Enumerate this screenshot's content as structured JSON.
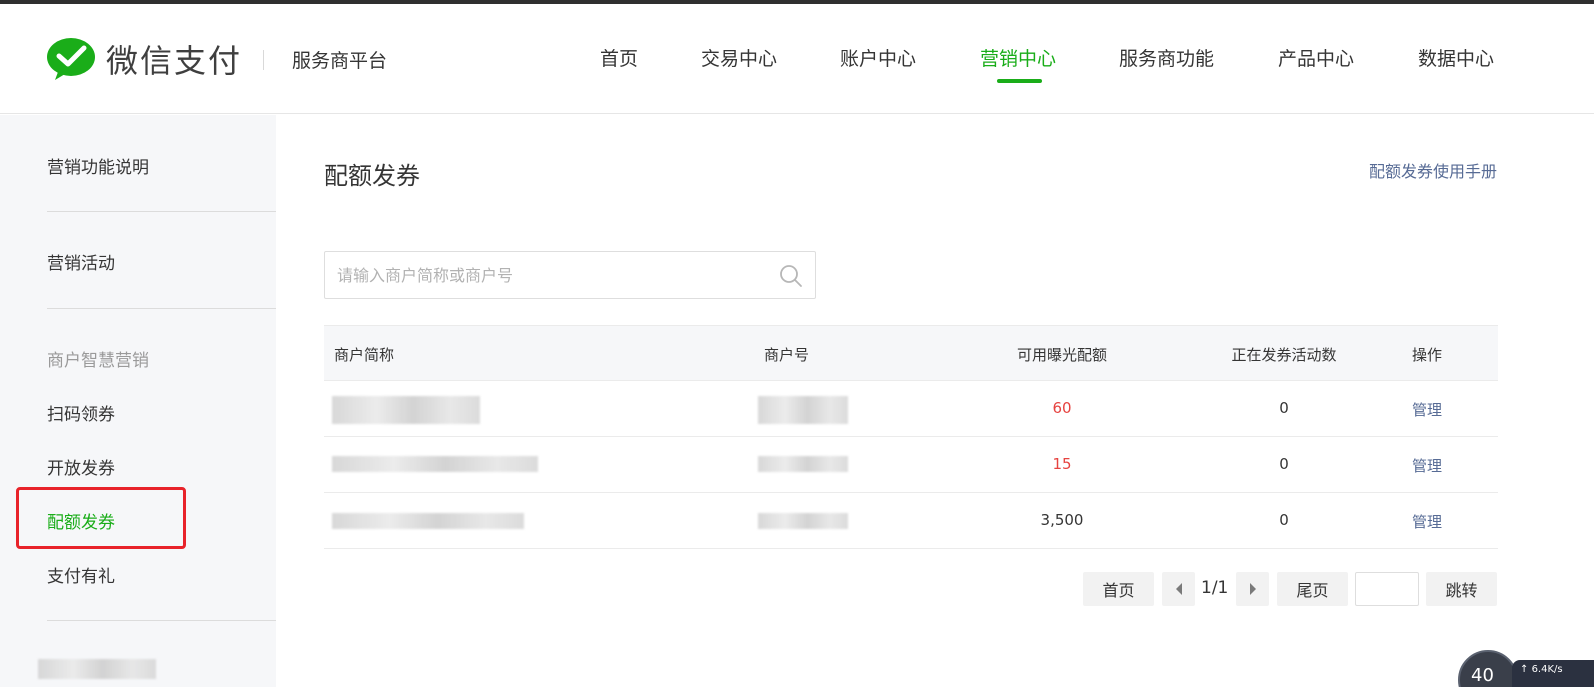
{
  "header": {
    "logo_text": "微信支付",
    "platform_name": "服务商平台",
    "nav": [
      "首页",
      "交易中心",
      "账户中心",
      "营销中心",
      "服务商功能",
      "产品中心",
      "数据中心"
    ],
    "active_nav": "营销中心"
  },
  "sidebar": {
    "item_marketing_intro": "营销功能说明",
    "item_marketing_activity": "营销活动",
    "group_merchant_smart": "商户智慧营销",
    "item_scan_coupon": "扫码领券",
    "item_open_coupon": "开放发券",
    "item_quota_coupon": "配额发券",
    "item_payment_gift": "支付有礼"
  },
  "main": {
    "title": "配额发券",
    "manual_link": "配额发券使用手册",
    "search_placeholder": "请输入商户简称或商户号"
  },
  "table": {
    "headers": [
      "商户简称",
      "商户号",
      "可用曝光配额",
      "正在发券活动数",
      "操作"
    ],
    "rows": [
      {
        "quota": "60",
        "active_count": "0",
        "action": "管理"
      },
      {
        "quota": "15",
        "active_count": "0",
        "action": "管理"
      },
      {
        "quota": "3,500",
        "active_count": "0",
        "action": "管理"
      }
    ]
  },
  "pager": {
    "first": "首页",
    "page_info": "1/1",
    "last": "尾页",
    "jump": "跳转"
  },
  "widget": {
    "value": "40",
    "speed": "6.4K/s"
  },
  "colors": {
    "accent_green": "#1aad19",
    "link_blue": "#576b95",
    "quota_red": "#e64340",
    "highlight_red": "#e8232a"
  }
}
